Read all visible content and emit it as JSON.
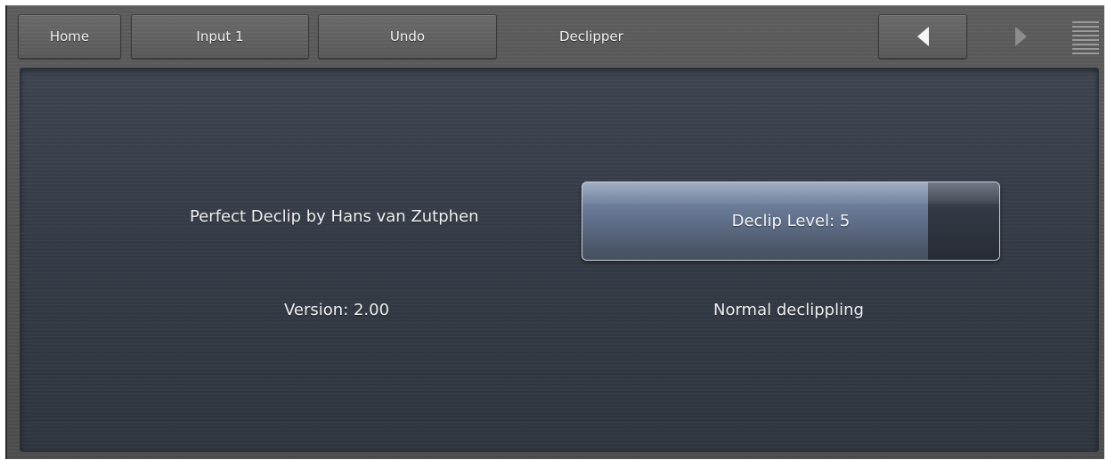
{
  "toolbar": {
    "home_label": "Home",
    "input_label": "Input 1",
    "undo_label": "Undo",
    "title": "Declipper",
    "prev_icon": "arrow-left-icon",
    "next_icon": "arrow-right-icon",
    "menu_icon": "menu-icon"
  },
  "panel": {
    "plugin_name": "Perfect Declip by Hans van Zutphen",
    "version": "Version: 2.00",
    "declip_button_label": "Declip Level: 5",
    "declip_level_fraction": 0.83,
    "mode_text": "Normal declippling"
  },
  "colors": {
    "panel_bg": "#353b46",
    "button_fill": "#6b7c98",
    "toolbar_bg": "#5a5a5a",
    "text": "#eef0f3"
  }
}
